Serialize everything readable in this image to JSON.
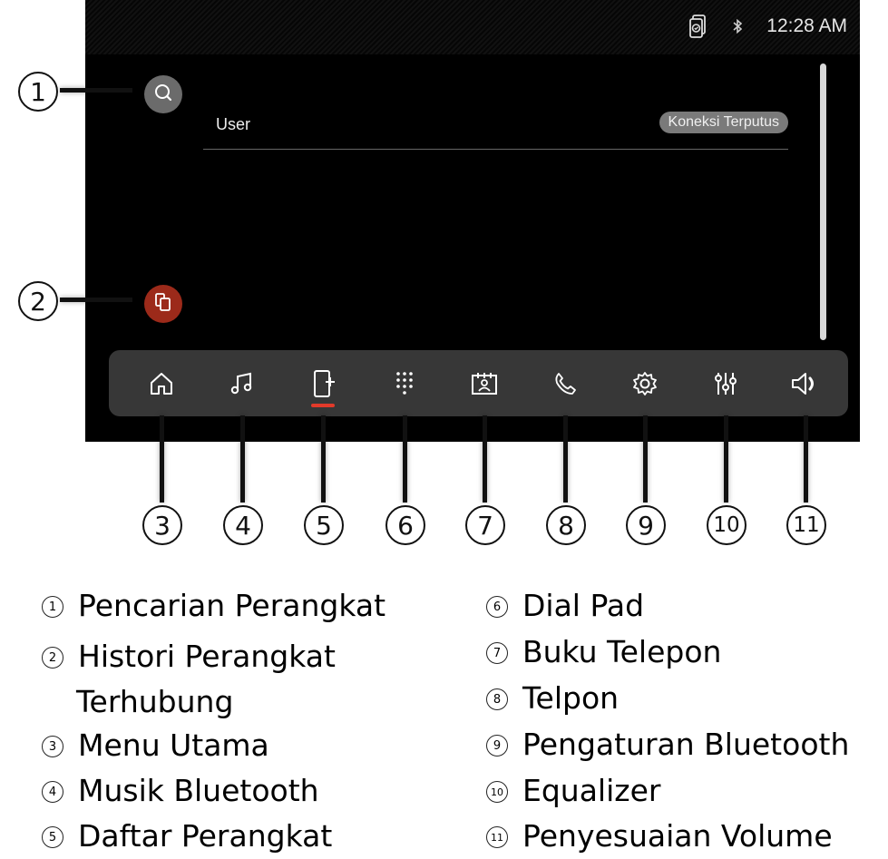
{
  "status": {
    "time": "12:28 AM"
  },
  "panel": {
    "user_label": "User",
    "connection_badge": "Koneksi Terputus"
  },
  "nav": {
    "items": [
      {
        "name": "nav-home-button",
        "icon": "home-icon"
      },
      {
        "name": "nav-music-button",
        "icon": "music-icon"
      },
      {
        "name": "nav-device-list-button",
        "icon": "device-add-icon"
      },
      {
        "name": "nav-dialpad-button",
        "icon": "dialpad-icon"
      },
      {
        "name": "nav-phonebook-button",
        "icon": "contacts-icon"
      },
      {
        "name": "nav-call-button",
        "icon": "phone-icon"
      },
      {
        "name": "nav-settings-button",
        "icon": "gear-icon"
      },
      {
        "name": "nav-equalizer-button",
        "icon": "equalizer-icon"
      },
      {
        "name": "nav-volume-button",
        "icon": "volume-icon"
      }
    ],
    "active_index": 2
  },
  "callouts": [
    "1",
    "2",
    "3",
    "4",
    "5",
    "6",
    "7",
    "8",
    "9",
    "10",
    "11"
  ],
  "legend": [
    {
      "num": "1",
      "text": "Pencarian Perangkat"
    },
    {
      "num": "2",
      "text": "Histori Perangkat"
    },
    {
      "num": "",
      "text": "Terhubung"
    },
    {
      "num": "3",
      "text": "Menu Utama"
    },
    {
      "num": "4",
      "text": "Musik Bluetooth"
    },
    {
      "num": "5",
      "text": "Daftar Perangkat"
    },
    {
      "num": "6",
      "text": "Dial Pad"
    },
    {
      "num": "7",
      "text": "Buku Telepon"
    },
    {
      "num": "8",
      "text": "Telpon"
    },
    {
      "num": "9",
      "text": "Pengaturan Bluetooth"
    },
    {
      "num": "10",
      "text": "Equalizer"
    },
    {
      "num": "11",
      "text": "Penyesuaian Volume"
    }
  ],
  "colors": {
    "accent_active": "#e23a2a",
    "history_button": "#9c2a1a",
    "search_button": "#6b6b6b"
  }
}
